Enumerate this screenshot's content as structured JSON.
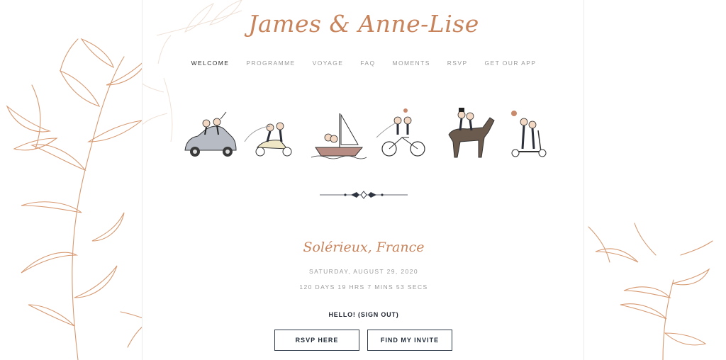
{
  "header": {
    "title": "James & Anne-Lise"
  },
  "nav": {
    "items": [
      "WELCOME",
      "PROGRAMME",
      "VOYAGE",
      "FAQ",
      "MOMENTS",
      "RSVP",
      "GET OUR APP"
    ],
    "active": "WELCOME"
  },
  "illustrations": [
    {
      "icon": "couple-in-car-icon"
    },
    {
      "icon": "couple-on-scooter-icon"
    },
    {
      "icon": "couple-in-sailboat-icon"
    },
    {
      "icon": "couple-on-tandem-bike-icon"
    },
    {
      "icon": "couple-on-horse-icon"
    },
    {
      "icon": "couple-on-kick-scooter-icon"
    }
  ],
  "event": {
    "location": "Solérieux, France",
    "date": "SATURDAY, AUGUST 29, 2020",
    "countdown": "120 DAYS 19 HRS 7 MINS 53 SECS"
  },
  "greeting": {
    "hello": "HELLO!",
    "sign_out": "(SIGN OUT)"
  },
  "buttons": {
    "rsvp": "RSVP HERE",
    "invite": "FIND MY INVITE"
  },
  "colors": {
    "accent": "#c8835a",
    "text_dark": "#2f3a4a",
    "muted": "#9a9a9a"
  }
}
